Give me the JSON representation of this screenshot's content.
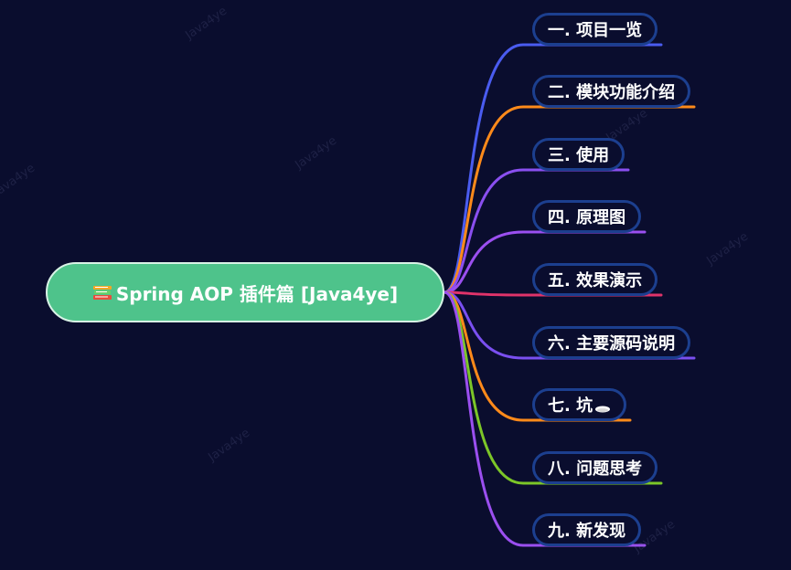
{
  "watermark_text": "Java4ye",
  "root": {
    "label": "Spring AOP 插件篇 [Java4ye]",
    "color": "#4ec38b"
  },
  "branches": [
    {
      "label": "一. 项目一览",
      "color": "#4a5cf0"
    },
    {
      "label": "二. 模块功能介绍",
      "color": "#ff8a1a"
    },
    {
      "label": "三. 使用",
      "color": "#8a4ff0"
    },
    {
      "label": "四. 原理图",
      "color": "#9b4ff0"
    },
    {
      "label": "五. 效果演示",
      "color": "#e0336a"
    },
    {
      "label": "六. 主要源码说明",
      "color": "#7a4ff0"
    },
    {
      "label": "七. 坑",
      "color": "#ff8a1a"
    },
    {
      "label": "八. 问题思考",
      "color": "#7cc628"
    },
    {
      "label": "九. 新发现",
      "color": "#9b4ff0"
    }
  ]
}
